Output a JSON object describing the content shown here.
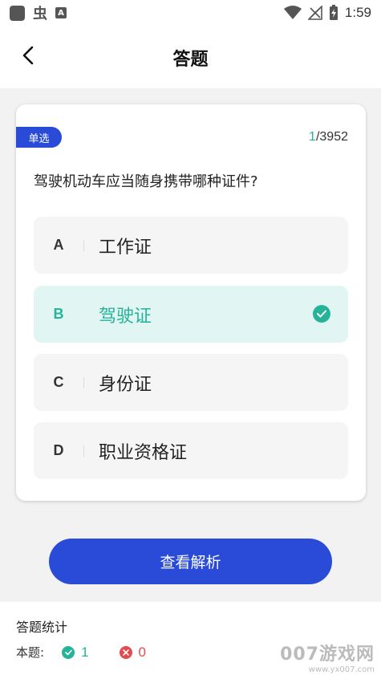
{
  "status_bar": {
    "time": "1:59",
    "app_glyph": "虫",
    "icons": [
      "app-square-icon",
      "bug-icon",
      "font-a-icon",
      "wifi-icon",
      "no-signal-icon",
      "battery-charging-icon"
    ]
  },
  "header": {
    "title": "答题",
    "back_icon": "chevron-left-icon"
  },
  "question": {
    "type_label": "单选",
    "current": "1",
    "total": "/3952",
    "text": "驾驶机动车应当随身携带哪种证件?",
    "options": [
      {
        "letter": "A",
        "text": "工作证",
        "selected": false
      },
      {
        "letter": "B",
        "text": "驾驶证",
        "selected": true
      },
      {
        "letter": "C",
        "text": "身份证",
        "selected": false
      },
      {
        "letter": "D",
        "text": "职业资格证",
        "selected": false
      }
    ]
  },
  "analysis_button": "查看解析",
  "stats": {
    "title": "答题统计",
    "label": "本题:",
    "correct": "1",
    "wrong": "0"
  },
  "watermark": {
    "main": "007游戏网",
    "sub": "www.yx007.com"
  },
  "colors": {
    "primary_blue": "#2a4ad8",
    "correct_green": "#26b39a",
    "wrong_red": "#e54b4b",
    "selected_bg": "#e1f6f3"
  }
}
